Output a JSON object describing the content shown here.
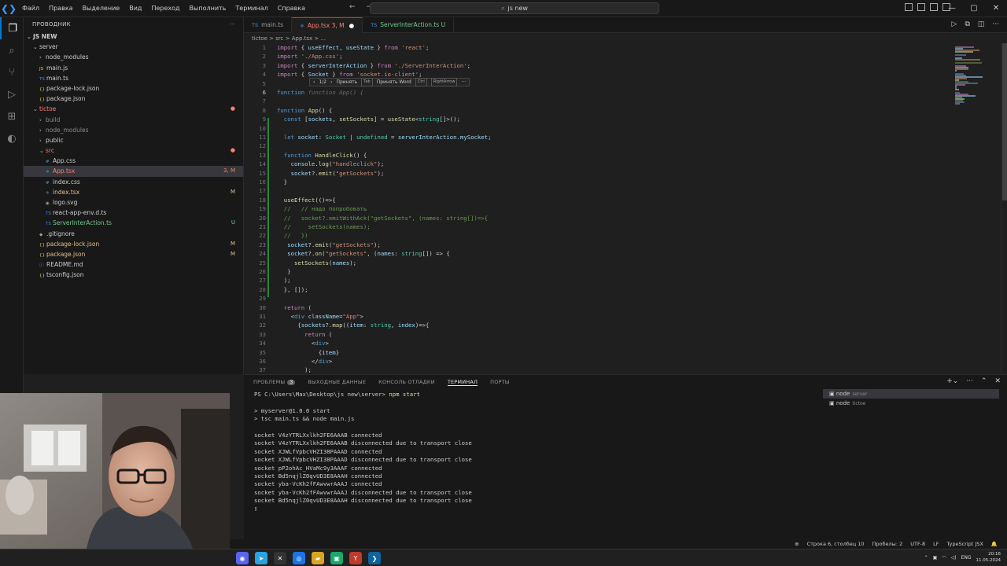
{
  "titlebar": {
    "menu": [
      "Файл",
      "Правка",
      "Выделение",
      "Вид",
      "Переход",
      "Выполнить",
      "Терминал",
      "Справка"
    ],
    "search": "js new"
  },
  "sidebar": {
    "title": "ПРОВОДНИК",
    "root": "JS NEW",
    "items": [
      {
        "label": "server",
        "indent": 1,
        "folder": true,
        "open": true,
        "cls": "",
        "badge": ""
      },
      {
        "label": "node_modules",
        "indent": 2,
        "folder": true,
        "open": false,
        "cls": "",
        "badge": ""
      },
      {
        "label": "main.js",
        "indent": 2,
        "folder": false,
        "icon": "JS",
        "cls": "",
        "badge": ""
      },
      {
        "label": "main.ts",
        "indent": 2,
        "folder": false,
        "icon": "TS",
        "cls": "",
        "badge": ""
      },
      {
        "label": "package-lock.json",
        "indent": 2,
        "folder": false,
        "icon": "{}",
        "cls": "",
        "badge": ""
      },
      {
        "label": "package.json",
        "indent": 2,
        "folder": false,
        "icon": "{}",
        "cls": "",
        "badge": ""
      },
      {
        "label": "tictoe",
        "indent": 1,
        "folder": true,
        "open": true,
        "cls": "c-err",
        "badge": "●"
      },
      {
        "label": "build",
        "indent": 2,
        "folder": true,
        "open": false,
        "cls": "c-dim",
        "badge": ""
      },
      {
        "label": "node_modules",
        "indent": 2,
        "folder": true,
        "open": false,
        "cls": "c-dim",
        "badge": ""
      },
      {
        "label": "public",
        "indent": 2,
        "folder": true,
        "open": false,
        "cls": "",
        "badge": ""
      },
      {
        "label": "src",
        "indent": 2,
        "folder": true,
        "open": true,
        "cls": "c-err",
        "badge": "●"
      },
      {
        "label": "App.css",
        "indent": 3,
        "folder": false,
        "icon": "#",
        "cls": "",
        "badge": ""
      },
      {
        "label": "App.tsx",
        "indent": 3,
        "folder": false,
        "icon": "⚛",
        "cls": "c-err",
        "badge": "3, M",
        "selected": true
      },
      {
        "label": "index.css",
        "indent": 3,
        "folder": false,
        "icon": "#",
        "cls": "",
        "badge": ""
      },
      {
        "label": "index.tsx",
        "indent": 3,
        "folder": false,
        "icon": "⚛",
        "cls": "c-mod",
        "badge": "M"
      },
      {
        "label": "logo.svg",
        "indent": 3,
        "folder": false,
        "icon": "◉",
        "cls": "",
        "badge": ""
      },
      {
        "label": "react-app-env.d.ts",
        "indent": 3,
        "folder": false,
        "icon": "TS",
        "cls": "",
        "badge": ""
      },
      {
        "label": "ServerInterAction.ts",
        "indent": 3,
        "folder": false,
        "icon": "TS",
        "cls": "c-unt",
        "badge": "U"
      },
      {
        "label": ".gitignore",
        "indent": 2,
        "folder": false,
        "icon": "◆",
        "cls": "",
        "badge": ""
      },
      {
        "label": "package-lock.json",
        "indent": 2,
        "folder": false,
        "icon": "{}",
        "cls": "c-mod",
        "badge": "M"
      },
      {
        "label": "package.json",
        "indent": 2,
        "folder": false,
        "icon": "{}",
        "cls": "c-mod",
        "badge": "M"
      },
      {
        "label": "README.md",
        "indent": 2,
        "folder": false,
        "icon": "ⓘ",
        "cls": "",
        "badge": ""
      },
      {
        "label": "tsconfig.json",
        "indent": 2,
        "folder": false,
        "icon": "{}",
        "cls": "",
        "badge": ""
      }
    ]
  },
  "tabs": [
    {
      "label": "main.ts",
      "icon": "TS",
      "active": false,
      "suffix": ""
    },
    {
      "label": "App.tsx 3, M",
      "icon": "⚛",
      "active": true,
      "suffix": "●"
    },
    {
      "label": "ServerInterAction.ts U",
      "icon": "TS",
      "active": false,
      "suffix": ""
    }
  ],
  "breadcrumb": "tictoe > src > App.tsx > ...",
  "inline_hint": {
    "counter": "1/2",
    "accept": "Принять",
    "accept_key": "Tab",
    "accept_word": "Принять Word",
    "word_key": "Ctrl",
    "arrow_key": "RightArrow"
  },
  "code": [
    {
      "n": "1",
      "html": "<span class=\"kw\">import</span> { <span class=\"vr\">useEffect</span>, <span class=\"vr\">useState</span> } <span class=\"kw\">from</span> <span class=\"st\">'react'</span>;"
    },
    {
      "n": "2",
      "html": "<span class=\"kw\">import</span> <span class=\"st\">'./App.css'</span>;"
    },
    {
      "n": "3",
      "html": "<span class=\"kw\">import</span> { <span class=\"vr\">serverInterAction</span> } <span class=\"kw\">from</span> <span class=\"st\">'./ServerInterAction'</span>;"
    },
    {
      "n": "4",
      "html": "<span class=\"kw\">import</span> { <span class=\"vr\">Socket</span> } <span class=\"kw\">from</span> <span class=\"st\">'socket.io-client'</span>;"
    },
    {
      "n": "5",
      "html": ""
    },
    {
      "n": "6",
      "html": "<span class=\"bl\">function</span> <span class=\"gh\">function App() {</span>",
      "cur": true
    },
    {
      "n": "7",
      "html": ""
    },
    {
      "n": "8",
      "html": "<span class=\"bl\">function</span> <span class=\"fn\">App</span>() {"
    },
    {
      "n": "9",
      "html": "  <span class=\"bl\">const</span> [<span class=\"vr\">sockets</span>, <span class=\"fn\">setSockets</span>] = <span class=\"fn\">useState</span>&lt;<span class=\"ty\">string</span>[]&gt;();"
    },
    {
      "n": "10",
      "html": ""
    },
    {
      "n": "11",
      "html": "  <span class=\"bl\">let</span> <span class=\"vr\">socket</span>: <span class=\"ty\">Socket</span> | <span class=\"ty\">undefined</span> = <span class=\"vr\">serverInterAction</span>.<span class=\"vr\">mySocket</span>;"
    },
    {
      "n": "12",
      "html": ""
    },
    {
      "n": "13",
      "html": "  <span class=\"bl\">function</span> <span class=\"fn\">HandleClick</span>() {"
    },
    {
      "n": "14",
      "html": "    <span class=\"vr\">console</span>.<span class=\"fn\">log</span>(<span class=\"st\">\"handleclick\"</span>);"
    },
    {
      "n": "15",
      "html": "    <span class=\"vr\">socket</span>?.<span class=\"fn\">emit</span>(<span class=\"st\">\"getSockets\"</span>);"
    },
    {
      "n": "16",
      "html": "  }"
    },
    {
      "n": "17",
      "html": ""
    },
    {
      "n": "18",
      "html": "  <span class=\"fn\">useEffect</span>(()=&gt;{"
    },
    {
      "n": "19",
      "html": "  <span class=\"cm\">//   // надо попробовать</span>"
    },
    {
      "n": "20",
      "html": "  <span class=\"cm\">//   socket?.emitWithAck(\"getSockets\", (names: string[])=&gt;{</span>"
    },
    {
      "n": "21",
      "html": "  <span class=\"cm\">//     setSockets(names);</span>"
    },
    {
      "n": "22",
      "html": "  <span class=\"cm\">//   })</span>"
    },
    {
      "n": "23",
      "html": "   <span class=\"vr\">socket</span>?.<span class=\"fn\">emit</span>(<span class=\"st\">\"getSockets\"</span>);"
    },
    {
      "n": "24",
      "html": "   <span class=\"vr\">socket</span>?.<span class=\"fn\">on</span>(<span class=\"st\">\"getSockets\"</span>, (<span class=\"vr\">names</span>: <span class=\"ty\">string</span>[]) =&gt; {"
    },
    {
      "n": "25",
      "html": "     <span class=\"fn\">setSockets</span>(<span class=\"vr\">names</span>);"
    },
    {
      "n": "26",
      "html": "   }"
    },
    {
      "n": "27",
      "html": "  );"
    },
    {
      "n": "28",
      "html": "  }, []);"
    },
    {
      "n": "29",
      "html": ""
    },
    {
      "n": "30",
      "html": "  <span class=\"kw\">return</span> ("
    },
    {
      "n": "31",
      "html": "    &lt;<span class=\"bl\">div</span> <span class=\"vr\">className</span>=<span class=\"st\">\"App\"</span>&gt;"
    },
    {
      "n": "32",
      "html": "      {<span class=\"vr\">sockets</span>?.<span class=\"fn\">map</span>((<span class=\"vr\">item</span>: <span class=\"ty\">string</span>, <span class=\"vr\">index</span>)=&gt;{"
    },
    {
      "n": "33",
      "html": "        <span class=\"kw\">return</span> ("
    },
    {
      "n": "34",
      "html": "          &lt;<span class=\"bl\">div</span>&gt;"
    },
    {
      "n": "35",
      "html": "            {<span class=\"vr\">item</span>}"
    },
    {
      "n": "36",
      "html": "          &lt;/<span class=\"bl\">div</span>&gt;"
    },
    {
      "n": "37",
      "html": "        );"
    }
  ],
  "panel": {
    "tabs": [
      "ПРОБЛЕМЫ",
      "ВЫХОДНЫЕ ДАННЫЕ",
      "КОНСОЛЬ ОТЛАДКИ",
      "ТЕРМИНАЛ",
      "ПОРТЫ"
    ],
    "problems_count": "3",
    "active_tab": "ТЕРМИНАЛ"
  },
  "terminal": {
    "prompt_path": "PS C:\\Users\\Max\\Desktop\\js new\\server>",
    "prompt_cmd": "npm start",
    "lines": [
      "",
      "> myserver@1.0.0 start",
      "> tsc main.ts && node main.js",
      "",
      "socket V4zYTRLXxlkh2FE6AAAB connected",
      "socket V4zYTRLXxlkh2FE6AAAB disconnected due to transport close",
      "socket XJWLfVpbcVHZI38PAAAD connected",
      "socket XJWLfVpbcVHZI38PAAAD disconnected due to transport close",
      "socket pP2ohAc_HVaMc9y3AAAF connected",
      "socket Bd5nqjlZ0qvUD3E8AAAH connected",
      "socket yba-VcKh2fFAwvwrAAAJ connected",
      "socket yba-VcKh2fFAwvwrAAAJ disconnected due to transport close",
      "socket Bd5nqjlZ0qvUD3E8AAAH disconnected due to transport close"
    ],
    "sessions": [
      {
        "name": "node",
        "dir": "server"
      },
      {
        "name": "node",
        "dir": "tictoe"
      }
    ]
  },
  "statusbar": {
    "position": "Строка 6, столбец 10",
    "spaces": "Пробелы: 2",
    "encoding": "UTF-8",
    "eol": "LF",
    "language": "TypeScript JSX"
  },
  "taskbar": {
    "lang": "ENG",
    "time": "20:16",
    "date": "11.05.2024"
  },
  "colors": {
    "accent": "#0078d4",
    "editor_bg": "#1f1f1f",
    "modified": "#e2c08d",
    "untracked": "#73c991",
    "error": "#f88070"
  }
}
